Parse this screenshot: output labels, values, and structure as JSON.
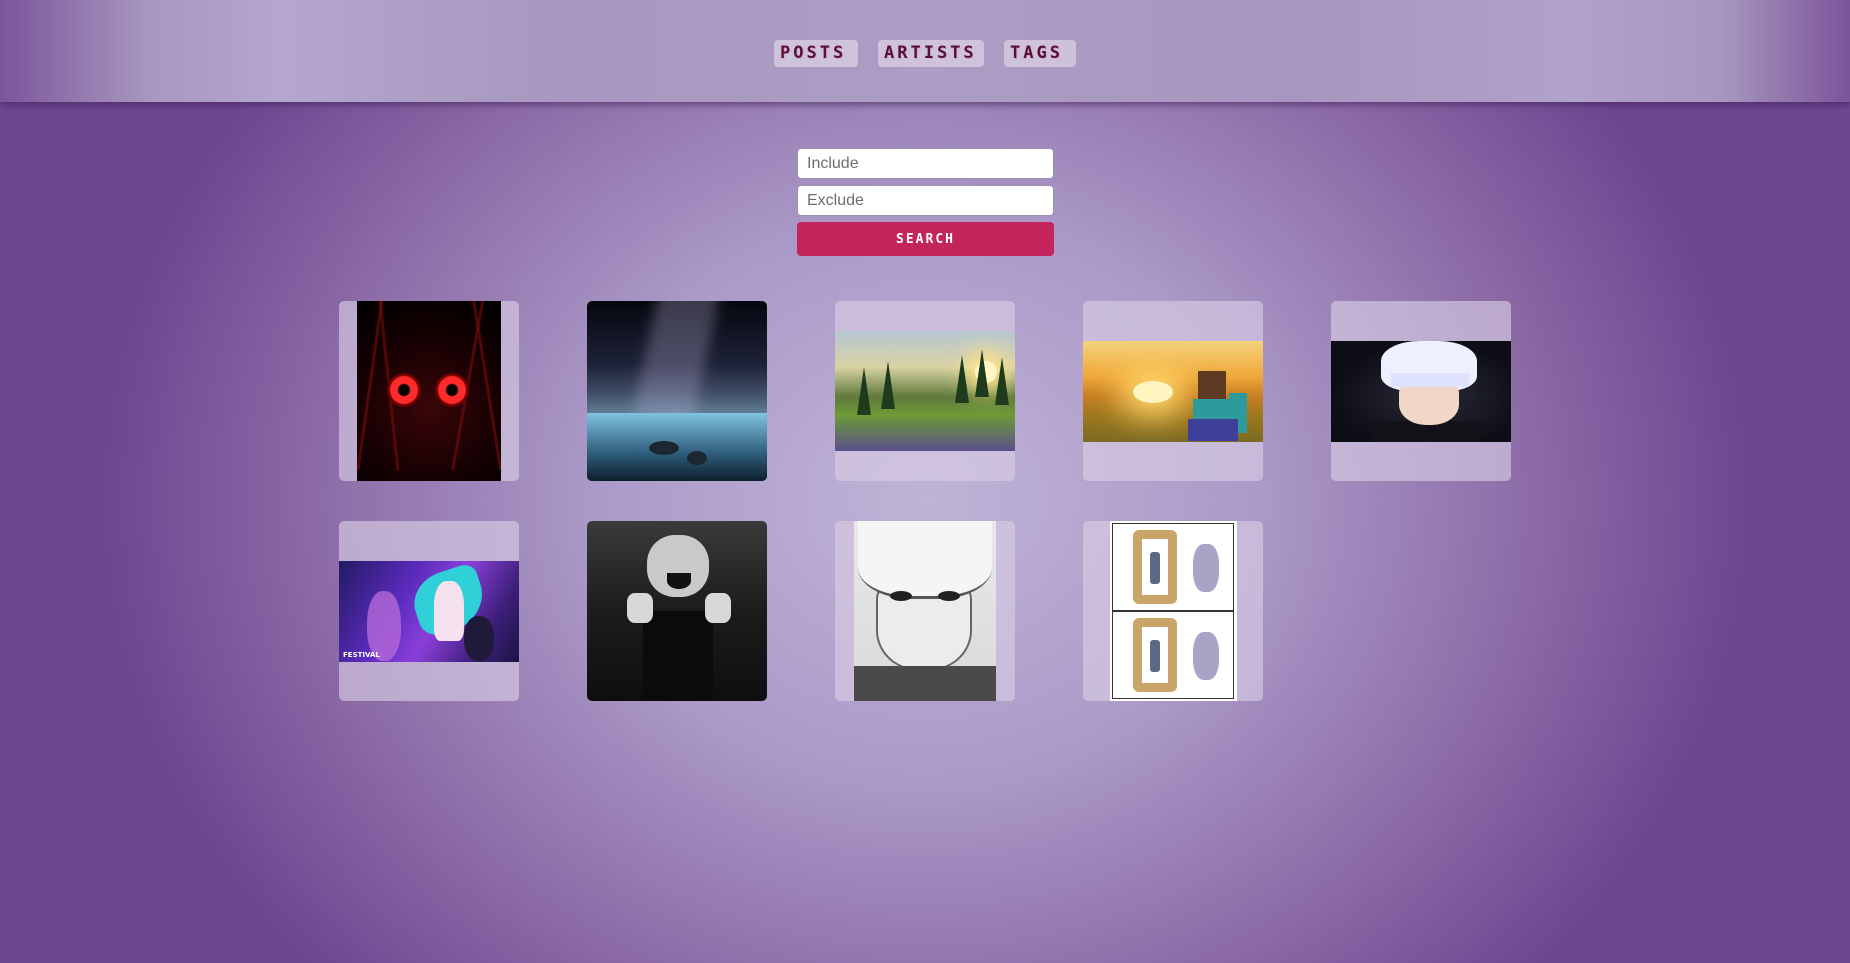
{
  "nav": {
    "posts": "POSTS",
    "artists": "ARTISTS",
    "tags": "TAGS"
  },
  "search": {
    "include_placeholder": "Include",
    "exclude_placeholder": "Exclude",
    "button_label": "SEARCH"
  },
  "theme": {
    "accent": "#c4245c",
    "nav_text": "#5a1030",
    "background": "#ab9ac8"
  },
  "posts": [
    {
      "subject": "dark creature with red eyes"
    },
    {
      "subject": "night sky over mountain lake"
    },
    {
      "subject": "meadow with pine trees at sunset"
    },
    {
      "subject": "minecraft steve in golden field"
    },
    {
      "subject": "white-haired anime character"
    },
    {
      "subject": "anime singer festival art",
      "caption": "FESTIVAL"
    },
    {
      "subject": "monochrome manga character laughing"
    },
    {
      "subject": "white-haired manga character"
    },
    {
      "subject": "two-panel comic with portal frame"
    }
  ]
}
